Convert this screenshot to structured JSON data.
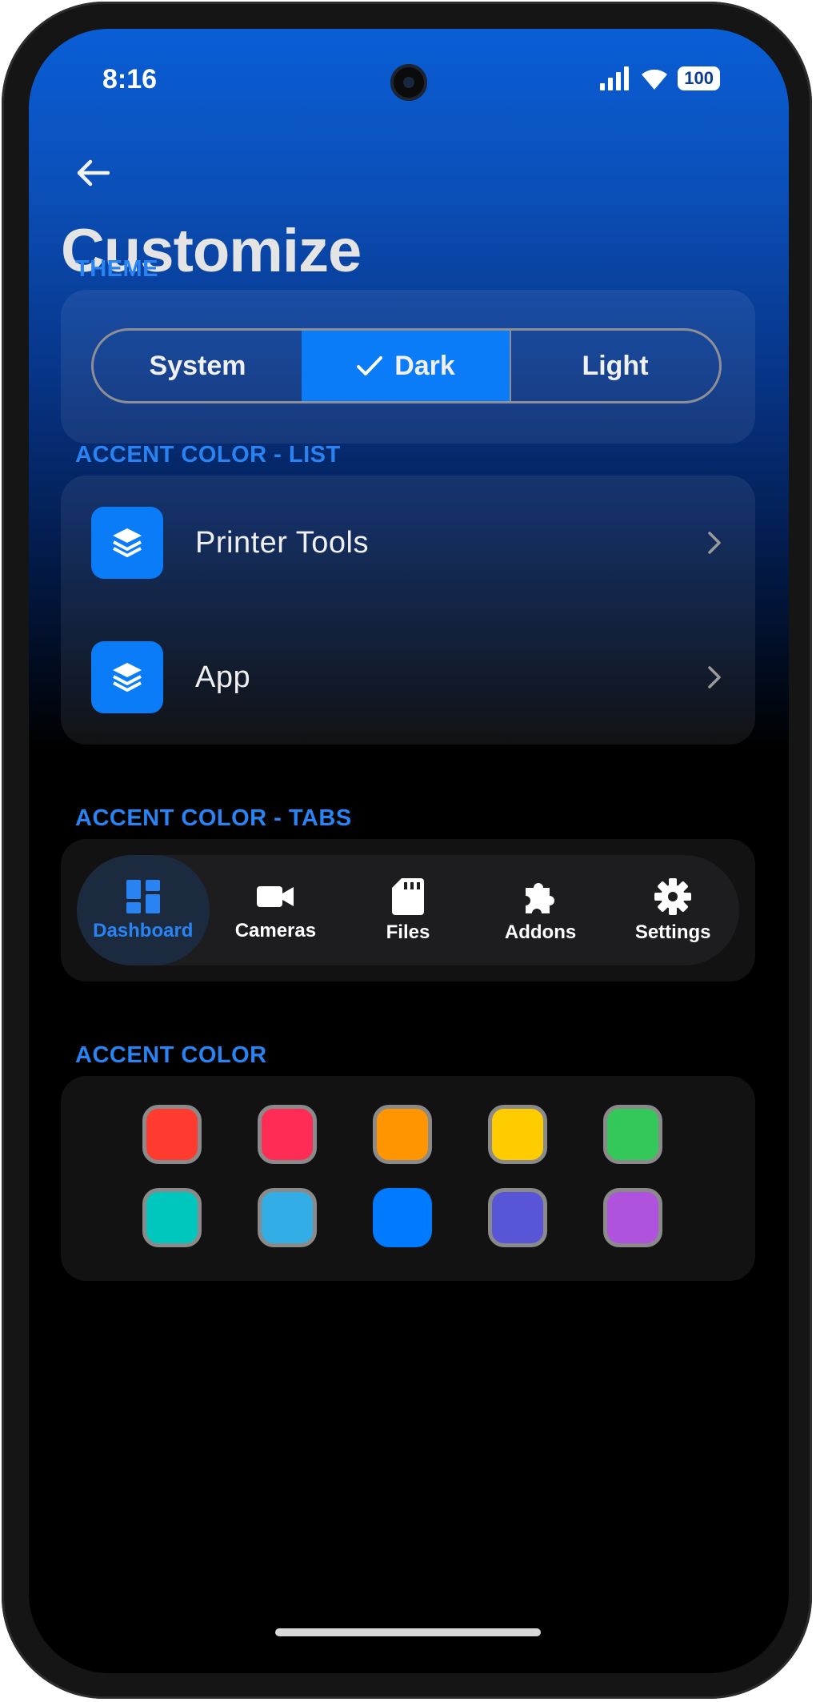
{
  "status_bar": {
    "time": "8:16",
    "battery": "100"
  },
  "page": {
    "title": "Customize"
  },
  "theme": {
    "section_label": "THEME",
    "options": [
      "System",
      "Dark",
      "Light"
    ],
    "selected": "Dark"
  },
  "accent_list": {
    "section_label": "ACCENT COLOR - LIST",
    "items": [
      {
        "label": "Printer Tools",
        "icon": "layers-icon"
      },
      {
        "label": "App",
        "icon": "layers-icon"
      }
    ]
  },
  "accent_tabs": {
    "section_label": "ACCENT COLOR - TABS",
    "tabs": [
      {
        "label": "Dashboard",
        "icon": "dashboard-icon"
      },
      {
        "label": "Cameras",
        "icon": "video-camera-icon"
      },
      {
        "label": "Files",
        "icon": "sd-card-icon"
      },
      {
        "label": "Addons",
        "icon": "puzzle-icon"
      },
      {
        "label": "Settings",
        "icon": "gear-icon"
      }
    ],
    "selected": "Dashboard"
  },
  "accent_color": {
    "section_label": "ACCENT COLOR",
    "swatches": [
      "#ff3b30",
      "#ff2d55",
      "#ff9500",
      "#ffcc00",
      "#34c759",
      "#00c7be",
      "#32ade6",
      "#007aff",
      "#5856d6",
      "#af52de"
    ],
    "selected": "#007aff"
  },
  "colors": {
    "accent": "#0a7cf7",
    "section_label": "#2a83f2"
  }
}
